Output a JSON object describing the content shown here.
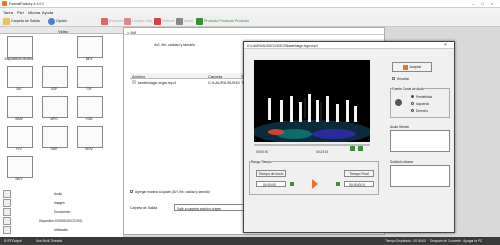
{
  "app": {
    "title": "FormatFactory 4.3.0.0"
  },
  "menu": [
    "Tarea",
    "Piel",
    "Idioma",
    "Ayuda"
  ],
  "toolbar": {
    "items": [
      "Carpeta de Salida",
      "Opción",
      "Remover",
      "Limpiar Lista",
      "Detener",
      "Iniciar",
      "Producto Producto Producto"
    ]
  },
  "left": {
    "section_header": "Video",
    "categories": [
      {
        "label": "Dispositivos Móviles"
      },
      {
        "label": "MP4"
      },
      {
        "label": "AVI"
      },
      {
        "label": "3GP"
      },
      {
        "label": "GIF"
      },
      {
        "label": "WMV"
      },
      {
        "label": "MPG"
      },
      {
        "label": "VOB"
      },
      {
        "label": "FLV"
      },
      {
        "label": "SWF"
      },
      {
        "label": "MOV"
      },
      {
        "label": "MKV"
      }
    ],
    "sections": [
      "Audio",
      "Imagen",
      "Documento",
      "Dispositivo ROM\\DVD\\CD\\ISO",
      "Utilidades"
    ]
  },
  "list_window": {
    "title": "> AVI",
    "header_label": "AVI, file, calidad y tamaño",
    "columns": [
      "Archivo",
      "Carpeta",
      "Tamaño"
    ],
    "rows": [
      {
        "file": "lawteldage-legio.mp4",
        "folder": "C:\\LAURA BUSDO\\...",
        "size": "Ta..."
      }
    ],
    "add_muted_label": "Agregar mudera al ajuste (AVI, file, calidad y tamaño)",
    "output_label": "Carpeta de Salida",
    "output_value": "Salir a carpeta archivo origen",
    "cancel_label": "Cambiar",
    "ok_label": "OK"
  },
  "popup": {
    "title": "D:\\LAURA BUSDO\\VIDEOS\\lawteldage-legio.mp4",
    "time_start": "00:00:00",
    "time_end": "00:23:15",
    "crop_label": "Recortar",
    "aceptar_label": "Aceptar",
    "range_label": "Rango Tiempo",
    "start_btn": "Tiempo de Inicio",
    "end_btn": "Tiempo Final",
    "start_value": "00:00:00",
    "end_value": "00:00:00.0",
    "audio_channel": {
      "title": "Fuente Canal de Audio",
      "options": [
        "Predefinido",
        "Izquierdo",
        "Derecho"
      ],
      "selected": 0
    },
    "audio_stream_label": "Audio Stream",
    "subtitle_label": "Subtítulo Idioma"
  },
  "status": {
    "left": "D:\\FFOutput",
    "middle": "Use Multi-Threads",
    "right_items": [
      "Tiempo Empleado : 00:00:00",
      "Después de Convertir : Apagar la PC"
    ]
  },
  "colors": {
    "accent": "#e7762a",
    "toolbar_green": "#3b8d3b"
  }
}
